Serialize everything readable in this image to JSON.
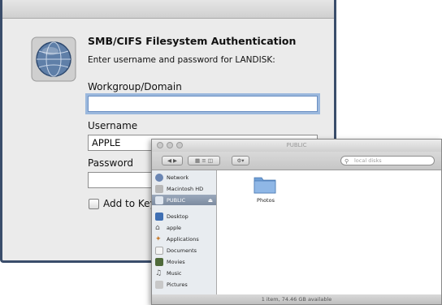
{
  "auth_dialog": {
    "heading": "SMB/CIFS Filesystem Authentication",
    "subheading": "Enter username and password for LANDISK:",
    "workgroup_label": "Workgroup/Domain",
    "workgroup_value": "",
    "username_label": "Username",
    "username_value": "APPLE",
    "password_label": "Password",
    "password_value": "",
    "keychain_label": "Add to Keychain"
  },
  "finder": {
    "title": "PUBLIC",
    "search_placeholder": "local disks",
    "sidebar": {
      "devices": [
        {
          "label": "Network",
          "icon": "network-icon"
        },
        {
          "label": "Macintosh HD",
          "icon": "hard-drive-icon"
        },
        {
          "label": "PUBLIC",
          "icon": "server-icon",
          "selected": true
        }
      ],
      "places": [
        {
          "label": "Desktop",
          "icon": "desktop-icon"
        },
        {
          "label": "apple",
          "icon": "home-icon"
        },
        {
          "label": "Applications",
          "icon": "applications-icon"
        },
        {
          "label": "Documents",
          "icon": "documents-icon"
        },
        {
          "label": "Movies",
          "icon": "movies-icon"
        },
        {
          "label": "Music",
          "icon": "music-icon"
        },
        {
          "label": "Pictures",
          "icon": "pictures-icon"
        }
      ]
    },
    "items": [
      {
        "label": "Photos",
        "icon": "folder-icon"
      }
    ],
    "status": "1 item, 74.46 GB available"
  },
  "colors": {
    "dialog_bg": "#ebebeb",
    "dialog_border": "#3a4d6b",
    "focus_ring": "#9bb8dd",
    "sidebar_selected": "#8a98ac"
  }
}
